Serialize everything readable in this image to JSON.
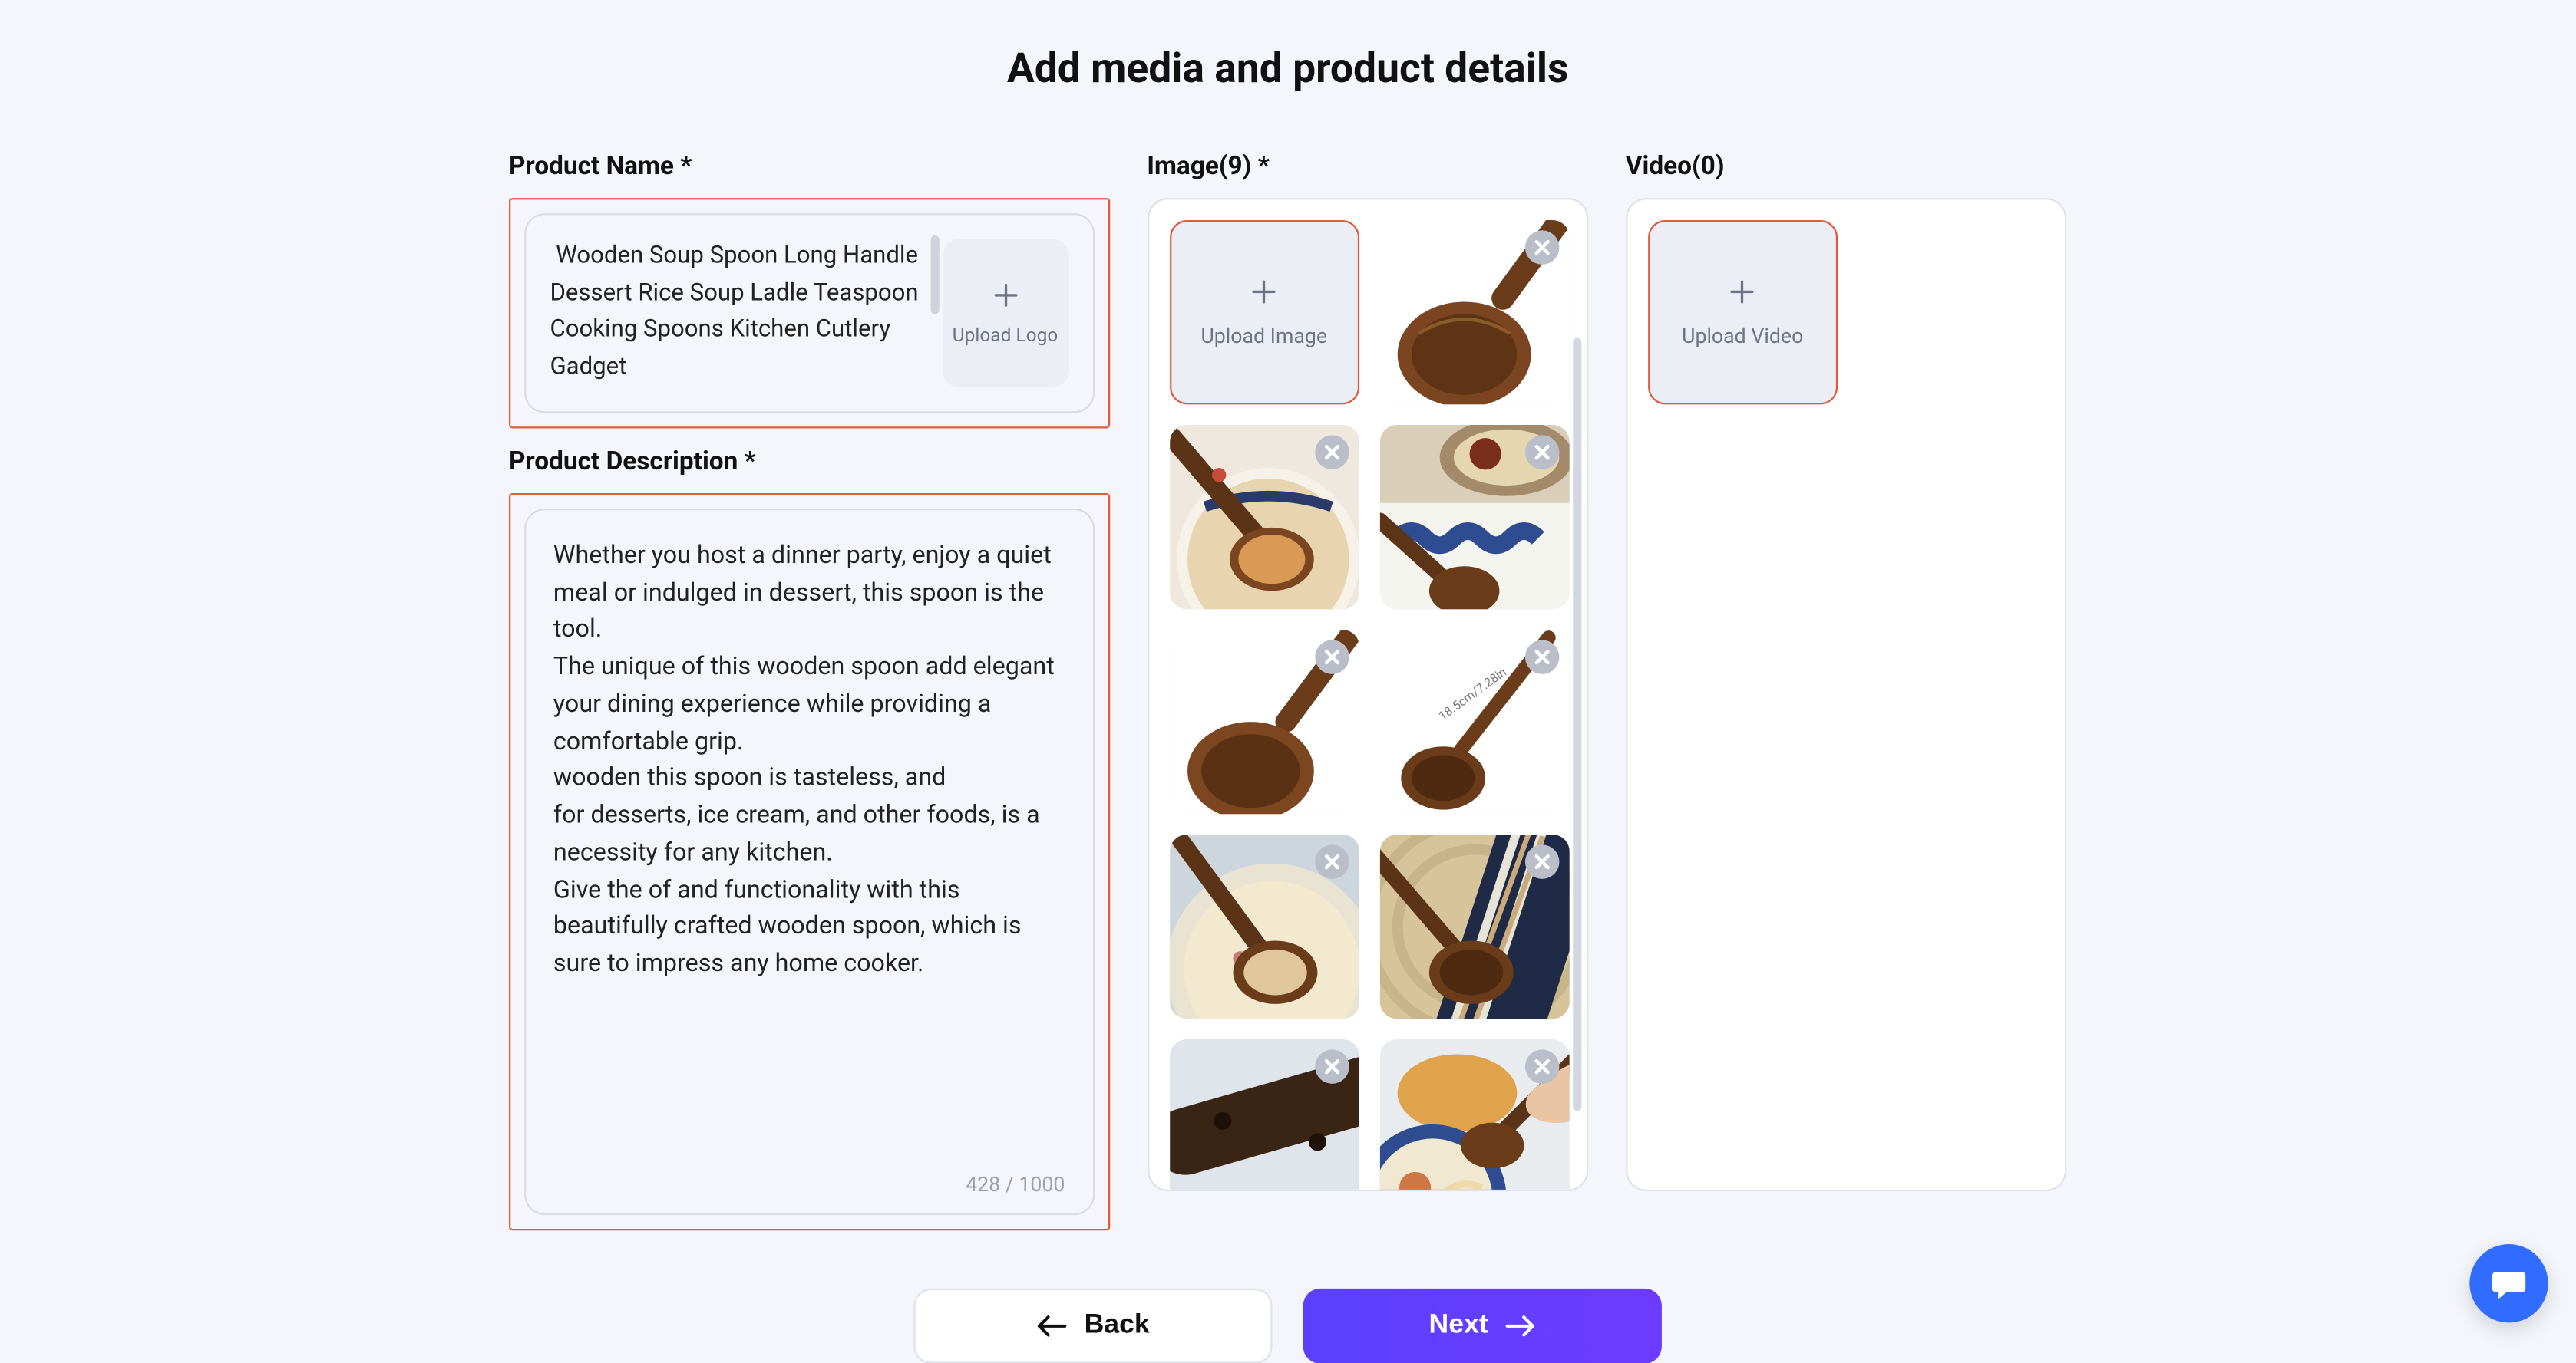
{
  "title": "Add media and product details",
  "left": {
    "nameLabel": "Product Name *",
    "nameValue": " Wooden Soup Spoon Long Handle Dessert Rice Soup Ladle Teaspoon Cooking Spoons Kitchen Cutlery Gadget",
    "uploadLogo": "Upload Logo",
    "descLabel": "Product Description *",
    "descValue": "Whether you host a dinner party, enjoy a quiet meal or indulged in dessert, this spoon is the tool.\nThe unique of this wooden spoon add elegant your dining experience while providing a comfortable grip.\nwooden this spoon is tasteless, and\nfor desserts, ice cream, and other foods, is a necessity for any kitchen.\nGive the of and functionality with this beautifully crafted wooden spoon, which is sure to impress any home cooker.",
    "descCounter": "428 / 1000"
  },
  "image": {
    "label": "Image(9) *",
    "uploadLabel": "Upload Image",
    "count": 9
  },
  "video": {
    "label": "Video(0)",
    "uploadLabel": "Upload Video",
    "count": 0
  },
  "footer": {
    "back": "Back",
    "next": "Next"
  }
}
